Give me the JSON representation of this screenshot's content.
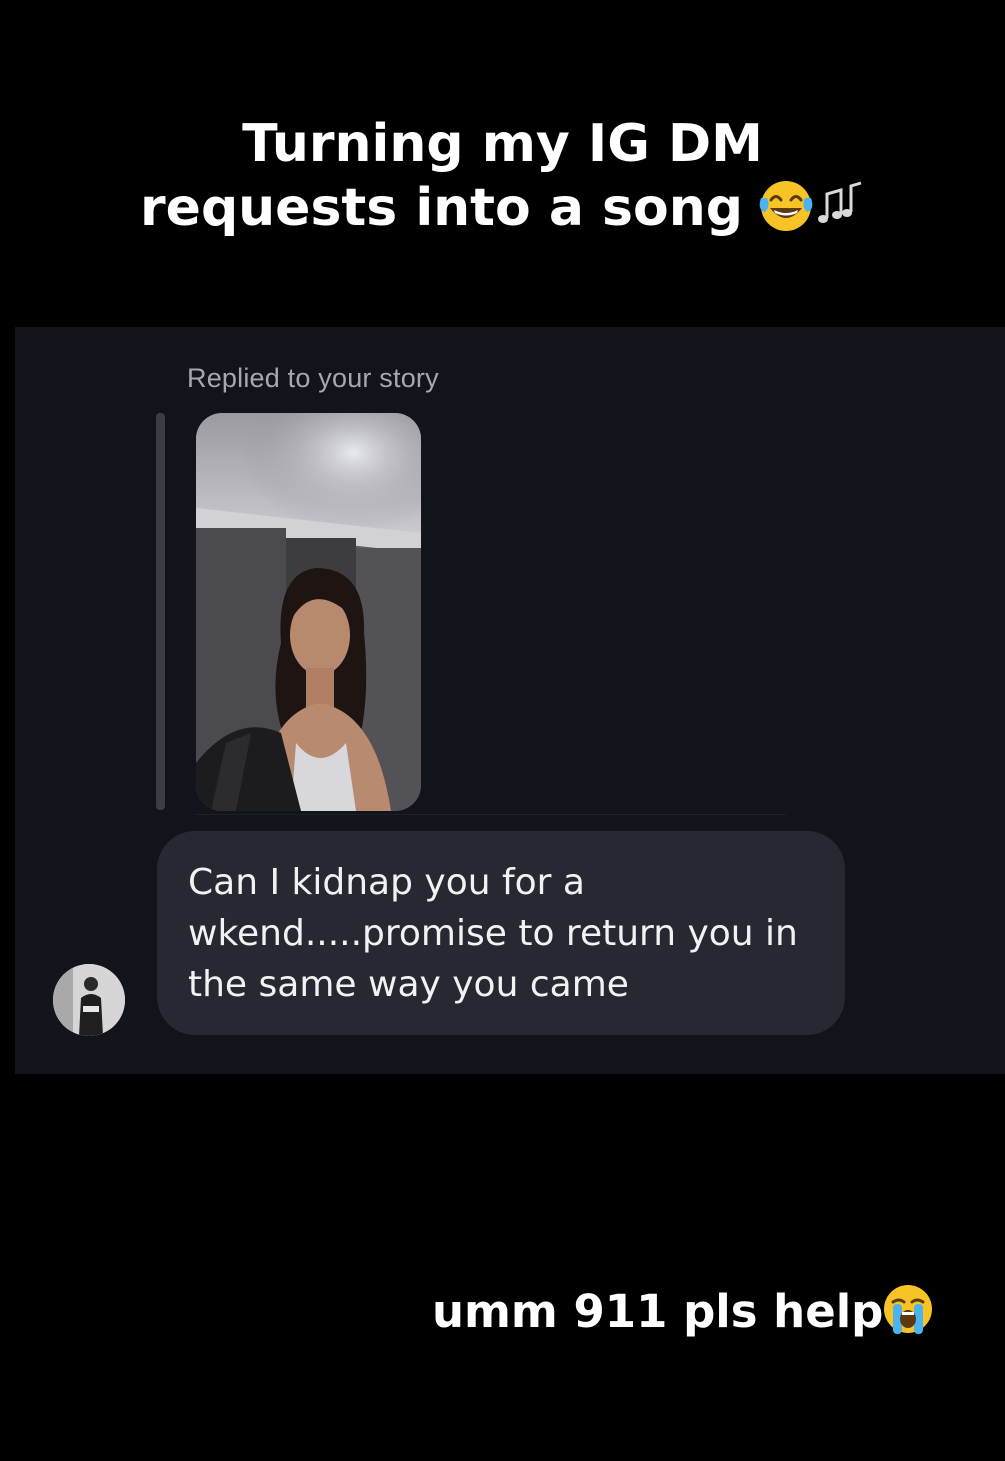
{
  "caption_top": {
    "line1": "Turning my IG DM",
    "line2": "requests into a song",
    "emojis": [
      "laughing-tears-emoji",
      "musical-notes-emoji"
    ]
  },
  "dm": {
    "reply_label": "Replied to your story",
    "message": {
      "line1": "Can I kidnap you for a",
      "line2": "wkend.....promise to return you in",
      "line3": "the same way you came"
    }
  },
  "caption_bottom": {
    "text": "umm 911 pls help",
    "emoji": "crying-face-emoji"
  },
  "colors": {
    "background": "#000000",
    "panel": "#11141b",
    "bubble": "#262932",
    "reply_label": "#a5a8ae",
    "emoji_yellow": "#f7c325",
    "emoji_tears": "#4ab3f0"
  }
}
